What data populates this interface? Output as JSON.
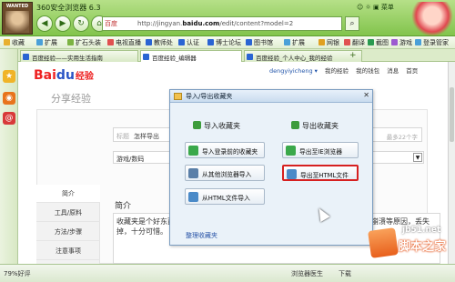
{
  "browser": {
    "title": "360安全浏览器 6.3",
    "avatar_caption": "WANTED",
    "address_engine": "百度",
    "url_prefix": "http://jingyan.",
    "url_domain": "baidu.com",
    "url_suffix": "/edit/content?model=2",
    "top_right": "☺  ☼  ▣  菜单",
    "nav": {
      "back": "◀",
      "forward": "▶",
      "refresh": "↻",
      "home": "⌂"
    }
  },
  "bookmarks": [
    {
      "label": "收藏",
      "color": "#e8b030"
    },
    {
      "label": "扩展",
      "color": "#4aa0d8"
    },
    {
      "label": "扩石头装",
      "color": "#7cb342"
    },
    {
      "label": "电视直播",
      "color": "#e05050"
    },
    {
      "label": "教师处",
      "color": "#2a64d3"
    },
    {
      "label": "认证",
      "color": "#2a64d3"
    },
    {
      "label": "博士论坛",
      "color": "#2a64d3"
    },
    {
      "label": "图书馆",
      "color": "#2a64d3"
    },
    {
      "label": "扩展",
      "color": "#4aa0d8"
    },
    {
      "label": "网银",
      "color": "#e0a020"
    },
    {
      "label": "翻译",
      "color": "#e05050"
    },
    {
      "label": "截图",
      "color": "#2a9a50"
    },
    {
      "label": "游戏",
      "color": "#9c5ad0"
    },
    {
      "label": "登录管家",
      "color": "#4aa0d8"
    }
  ],
  "tabs": [
    {
      "label": "百度经验——实用生活指南",
      "active": false
    },
    {
      "label": "百度经验_编辑器",
      "active": true
    },
    {
      "label": "百度经验_个人中心_我的经验",
      "active": false
    }
  ],
  "page": {
    "logo_bai": "Bai",
    "logo_du": "du",
    "logo_jingyan": "经验",
    "user": "dengyiyicheng ▾",
    "links": [
      "我的经验",
      "我的钱包",
      "消息",
      "首页"
    ],
    "share_title": "分享经验",
    "title_label": "标题",
    "title_value": "怎样导出",
    "title_hint": "最多22个字",
    "category": "游戏/数码",
    "left_nav": [
      "简介",
      "工具/原料",
      "方法/步骤",
      "注意事项"
    ],
    "intro_label": "简介",
    "intro_text": "收藏夹是个好东西，每个人都有自己的收藏夹，收藏好后就会遇到换电脑或系统崩溃等原因，丢失掉，十分可惜。"
  },
  "dialog": {
    "title": "导入/导出收藏夹",
    "close": "✕",
    "import_header": "导入收藏夹",
    "export_header": "导出收藏夹",
    "import_buttons": [
      "导入登录前的收藏夹",
      "从其他浏览器导入",
      "从HTML文件导入"
    ],
    "export_buttons": [
      "导出至IE浏览器",
      "导出至HTML文件"
    ],
    "highlighted": "导出至HTML文件",
    "organize_link": "整理收藏夹"
  },
  "status": {
    "zoom": "79%好评",
    "doctor": "浏览器医生",
    "download": "下载",
    "mode": "100%"
  },
  "watermark": {
    "site": "jb51.net",
    "brand": "脚本之家"
  }
}
